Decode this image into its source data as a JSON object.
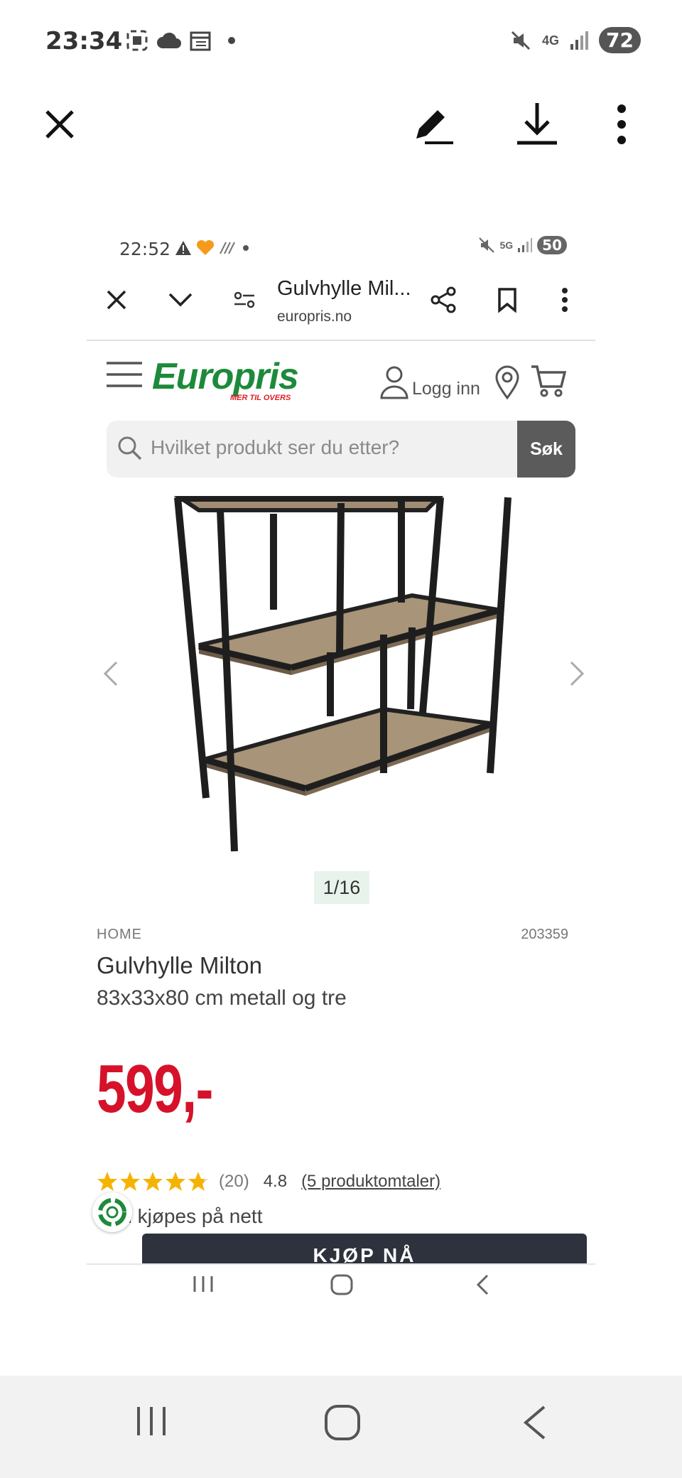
{
  "status_bar": {
    "time": "23:34",
    "network": "4G",
    "battery": "72",
    "icons": [
      "screenshot-icon",
      "cloud-icon",
      "calendar-icon",
      "dot-icon",
      "mute-icon",
      "signal-icon"
    ]
  },
  "viewer_toolbar": {
    "icons": [
      "close-icon",
      "edit-icon",
      "download-icon",
      "more-icon"
    ]
  },
  "inner_status_bar": {
    "time": "22:52",
    "network": "5G",
    "battery": "50"
  },
  "browser": {
    "page_title": "Gulvhylle Mil...",
    "url": "europris.no"
  },
  "site_header": {
    "logo_text": "Europris",
    "logo_tagline": "MER TIL OVERS",
    "login_label": "Logg inn"
  },
  "search": {
    "placeholder": "Hvilket produkt ser du etter?",
    "button_label": "Søk"
  },
  "gallery": {
    "counter": "1/16"
  },
  "product": {
    "brand": "HOME",
    "sku": "203359",
    "name": "Gulvhylle Milton",
    "subtitle": "83x33x80 cm metall og tre",
    "price": "599,-",
    "rating_count": "(20)",
    "rating_score": "4.8",
    "rating_stars": 4.8,
    "reviews_link": "(5 produktomtaler)",
    "availability": "Kan kjøpes på nett",
    "buy_label": "KJØP NÅ"
  },
  "colors": {
    "brand_green": "#1d8a3b",
    "price_red": "#d6122b",
    "star_yellow": "#f5b301",
    "buy_button": "#2e323d"
  }
}
